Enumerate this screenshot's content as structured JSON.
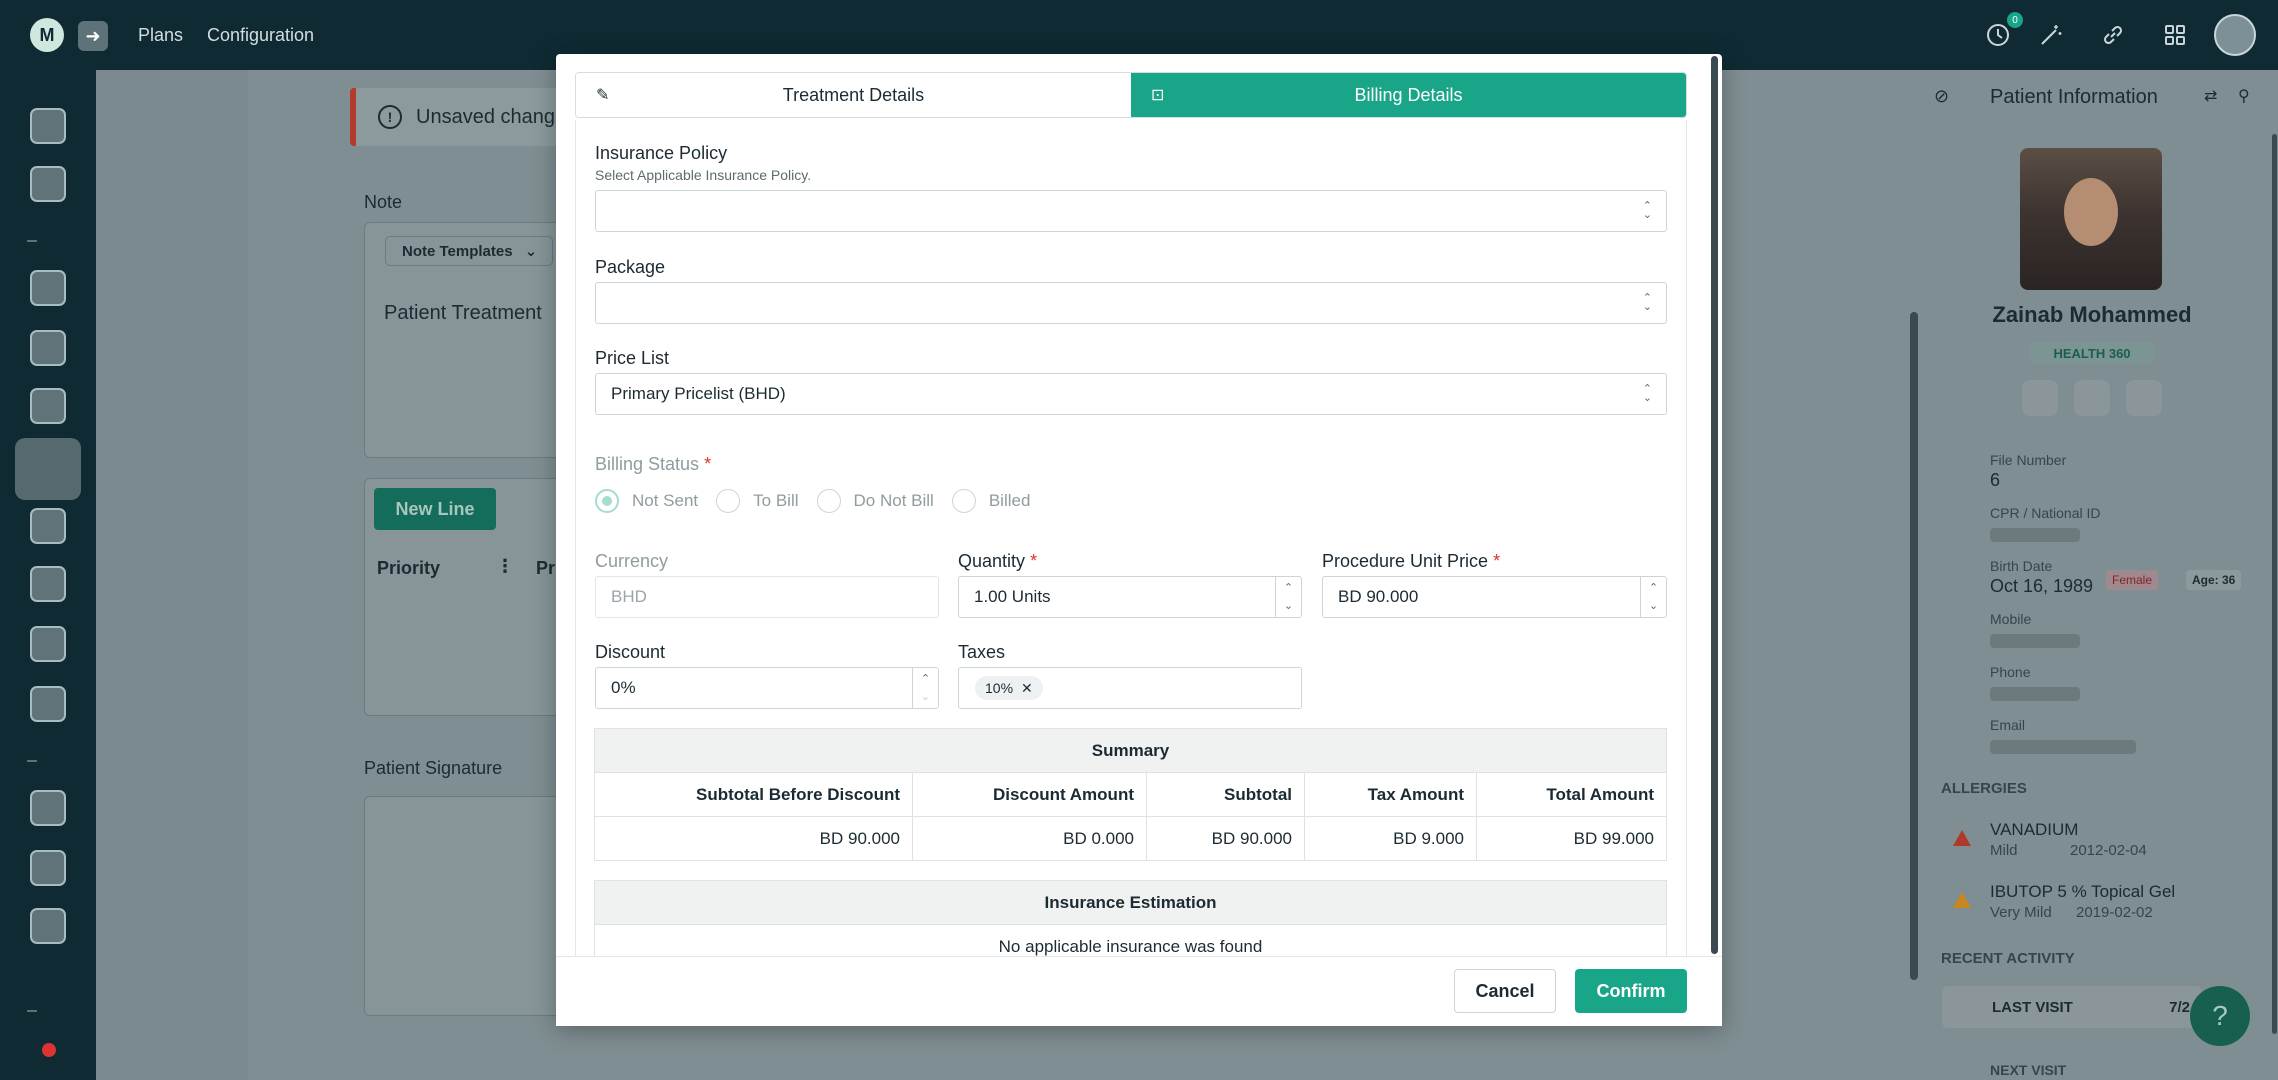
{
  "topbar": {
    "nav": [
      "Plans",
      "Configuration"
    ],
    "notification_count": "0",
    "icons": [
      "history-icon",
      "magic-wand-icon",
      "link-icon",
      "apps-grid-icon",
      "user-avatar"
    ]
  },
  "sidebar": {
    "icons": [
      "dashboard-icon",
      "patients-icon",
      "calendar-icon",
      "treatment-icon",
      "records-icon",
      "clinical-notes-icon",
      "billing-icon",
      "insurance-icon",
      "inventory-icon",
      "lab-icon",
      "reports-icon",
      "analytics-icon",
      "settings-icon"
    ]
  },
  "background_page": {
    "unsaved_text": "Unsaved chang",
    "note_label": "Note",
    "note_templates": "Note Templates",
    "note_text": "Patient Treatment",
    "new_line": "New Line",
    "col_priority": "Priority",
    "col_pr": "Pr",
    "signature_label": "Patient Signature"
  },
  "patient_panel": {
    "title": "Patient Information",
    "name": "Zainab Mohammed",
    "health_badge": "HEALTH 360",
    "file_number_label": "File Number",
    "file_number": "6",
    "cpr_label": "CPR / National ID",
    "birth_label": "Birth Date",
    "birth_date": "Oct 16, 1989",
    "gender": "Female",
    "age": "Age: 36",
    "mobile_label": "Mobile",
    "phone_label": "Phone",
    "email_label": "Email",
    "allergies_heading": "ALLERGIES",
    "allergies": [
      {
        "name": "VANADIUM",
        "severity": "Mild",
        "date": "2012-02-04"
      },
      {
        "name": "IBUTOP 5 % Topical Gel",
        "severity": "Very Mild",
        "date": "2019-02-02"
      }
    ],
    "recent_heading": "RECENT ACTIVITY",
    "last_visit": "LAST VISIT",
    "last_visit_date": "7/2",
    "next_visit": "NEXT VISIT"
  },
  "modal": {
    "tabs": [
      {
        "label": "Treatment Details",
        "active": false
      },
      {
        "label": "Billing Details",
        "active": true
      }
    ],
    "insurance_policy": {
      "label": "Insurance Policy",
      "sublabel": "Select Applicable Insurance Policy.",
      "value": ""
    },
    "package": {
      "label": "Package",
      "value": ""
    },
    "price_list": {
      "label": "Price List",
      "value": "Primary Pricelist (BHD)"
    },
    "billing_status": {
      "label": "Billing Status",
      "options": [
        "Not Sent",
        "To Bill",
        "Do Not Bill",
        "Billed"
      ],
      "selected": "Not Sent"
    },
    "currency": {
      "label": "Currency",
      "value": "BHD"
    },
    "quantity": {
      "label": "Quantity",
      "value": "1.00 Units"
    },
    "unit_price": {
      "label": "Procedure Unit Price",
      "value": "BD 90.000"
    },
    "discount": {
      "label": "Discount",
      "value": "0%"
    },
    "taxes": {
      "label": "Taxes",
      "chips": [
        "10%"
      ]
    },
    "summary": {
      "title": "Summary",
      "headers": [
        "Subtotal Before Discount",
        "Discount Amount",
        "Subtotal",
        "Tax Amount",
        "Total Amount"
      ],
      "values": [
        "BD 90.000",
        "BD 0.000",
        "BD 90.000",
        "BD 9.000",
        "BD 99.000"
      ]
    },
    "insurance_estimation": {
      "title": "Insurance Estimation",
      "message": "No applicable insurance was found"
    },
    "cancel": "Cancel",
    "confirm": "Confirm"
  },
  "colors": {
    "accent": "#19a688",
    "navy": "#0f2a33",
    "required": "#d9362b"
  }
}
